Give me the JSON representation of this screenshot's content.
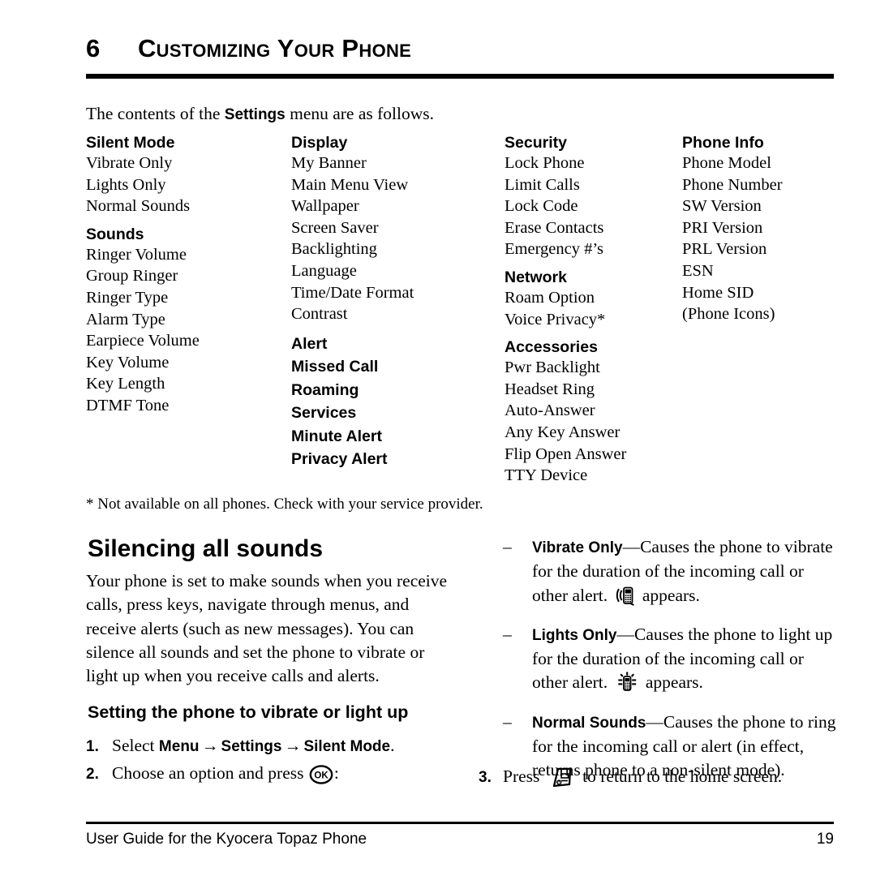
{
  "chapter": {
    "number": "6",
    "title": "Customizing Your Phone"
  },
  "intro": {
    "before": "The contents of the ",
    "bold": "Settings",
    "after": " menu are as follows."
  },
  "menu_columns": [
    {
      "groups": [
        {
          "heading": "Silent Mode",
          "items": [
            "Vibrate Only",
            "Lights Only",
            "Normal Sounds"
          ]
        },
        {
          "heading": "Sounds",
          "items": [
            "Ringer Volume",
            "Group Ringer",
            "Ringer Type",
            "Alarm Type",
            "Earpiece Volume",
            "Key Volume",
            "Key Length",
            "DTMF Tone"
          ]
        }
      ],
      "bold_entries": []
    },
    {
      "groups": [
        {
          "heading": "Display",
          "items": [
            "My Banner",
            "Main Menu View",
            "Wallpaper",
            "Screen Saver",
            "Backlighting",
            "Language",
            "Time/Date Format",
            "Contrast"
          ]
        }
      ],
      "bold_entries": [
        "Alert",
        "Missed Call",
        "Roaming",
        "Services",
        "Minute Alert",
        "Privacy Alert"
      ]
    },
    {
      "groups": [
        {
          "heading": "Security",
          "items": [
            "Lock Phone",
            "Limit Calls",
            "Lock Code",
            "Erase Contacts",
            "Emergency #’s"
          ]
        },
        {
          "heading": "Network",
          "items": [
            "Roam Option",
            "Voice Privacy*"
          ]
        },
        {
          "heading": "Accessories",
          "items": [
            "Pwr Backlight",
            "Headset Ring",
            "Auto-Answer",
            "Any Key Answer",
            "Flip Open Answer",
            "TTY Device"
          ]
        }
      ],
      "bold_entries": []
    },
    {
      "groups": [
        {
          "heading": "Phone Info",
          "items": [
            "Phone Model",
            "Phone Number",
            "SW Version",
            "PRI Version",
            "PRL Version",
            "ESN",
            "Home SID",
            "(Phone Icons)"
          ]
        }
      ],
      "bold_entries": []
    }
  ],
  "footnote": "* Not available on all phones. Check with your service provider.",
  "section": {
    "heading": "Silencing all sounds",
    "paragraph": "Your phone is set to make sounds when you receive calls, press keys, navigate through menus, and receive alerts (such as new messages). You can silence all sounds and set the phone to vibrate or light up when you receive calls and alerts.",
    "subheading": "Setting the phone to vibrate or light up"
  },
  "steps_left": [
    {
      "number": "1.",
      "parts": [
        {
          "type": "text",
          "value": "Select "
        },
        {
          "type": "bold",
          "value": "Menu"
        },
        {
          "type": "arrow",
          "value": "→"
        },
        {
          "type": "bold",
          "value": "Settings"
        },
        {
          "type": "arrow",
          "value": "→"
        },
        {
          "type": "bold",
          "value": "Silent Mode"
        },
        {
          "type": "text",
          "value": "."
        }
      ]
    },
    {
      "number": "2.",
      "parts": [
        {
          "type": "text",
          "value": "Choose an option and press "
        },
        {
          "type": "icon",
          "value": "ok-button-icon"
        },
        {
          "type": "text",
          "value": ":"
        }
      ]
    }
  ],
  "bullets": [
    {
      "dash": "–",
      "term": "Vibrate Only",
      "dash_sep": "—",
      "body_before": "Causes the phone to vibrate for the duration of the incoming call or other alert. ",
      "icon": "vibrate-phone-icon",
      "body_after": " appears."
    },
    {
      "dash": "–",
      "term": "Lights Only",
      "dash_sep": "—",
      "body_before": "Causes the phone to light up for the duration of the incoming call or other alert. ",
      "icon": "lights-phone-icon",
      "body_after": " appears."
    },
    {
      "dash": "–",
      "term": "Normal Sounds",
      "dash_sep": "—",
      "body_before": "Causes the phone to ring for the incoming call or alert (in effect, returns phone to a non-silent mode).",
      "icon": "",
      "body_after": ""
    }
  ],
  "steps_right": [
    {
      "number": "3.",
      "before": "Press ",
      "icon": "end-call-key-icon",
      "after": " to return to the home screen."
    }
  ],
  "footer": {
    "text": "User Guide for the Kyocera Topaz Phone",
    "page": "19"
  },
  "colors": {
    "text": "#000000",
    "background": "#ffffff"
  }
}
